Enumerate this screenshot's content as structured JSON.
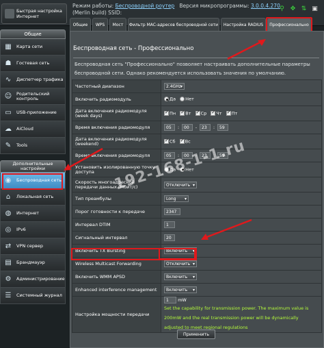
{
  "header": {
    "quick_setup_label": "Быстрая настройка Интернет",
    "mode_label": "Режим работы:",
    "mode_value": "Беспроводной роутер",
    "firmware_label": "Версия микропрограммы:",
    "firmware_value": "3.0.0.4.270",
    "build_text": "(Merlin build) SSID:"
  },
  "tabs": [
    {
      "label": "Общие"
    },
    {
      "label": "WPS"
    },
    {
      "label": "Мост"
    },
    {
      "label": "Фильтр MAC-адресов беспроводной сети"
    },
    {
      "label": "Настройка RADIUS"
    },
    {
      "label": "Профессионально"
    }
  ],
  "sidebar": {
    "general_header": "Общие",
    "general_items": [
      {
        "label": "Карта сети",
        "icon": "network-map-icon"
      },
      {
        "label": "Гостевая сеть",
        "icon": "guest-network-icon"
      },
      {
        "label": "Диспетчер трафика",
        "icon": "traffic-manager-icon"
      },
      {
        "label": "Родительский контроль",
        "icon": "parental-control-icon"
      },
      {
        "label": "USB-приложение",
        "icon": "usb-icon"
      },
      {
        "label": "AiCloud",
        "icon": "cloud-icon"
      },
      {
        "label": "Tools",
        "icon": "tools-icon"
      }
    ],
    "advanced_header": "Дополнительные настройки",
    "advanced_items": [
      {
        "label": "Беспроводная сеть",
        "icon": "wireless-icon"
      },
      {
        "label": "Локальная сеть",
        "icon": "lan-icon"
      },
      {
        "label": "Интернет",
        "icon": "internet-icon"
      },
      {
        "label": "IPv6",
        "icon": "ipv6-icon"
      },
      {
        "label": "VPN сервер",
        "icon": "vpn-icon"
      },
      {
        "label": "Брандмауэр",
        "icon": "firewall-icon"
      },
      {
        "label": "Администрирование",
        "icon": "admin-icon"
      },
      {
        "label": "Системный журнал",
        "icon": "log-icon"
      }
    ]
  },
  "panel": {
    "title": "Беспроводная сеть - Профессионально",
    "description": "Беспроводная сеть \"Профессионально\" позволяет настраивать дополнительные параметры беспроводной сети. Однако рекомендуется использовать значения по умолчанию."
  },
  "form": {
    "band_label": "Частотный диапазон",
    "band_value": "2.4GHz",
    "radio_label": "Включить радиомодуль",
    "yes": "Да",
    "no": "Нет",
    "weekdays_label": "Дата включения радиомодуля (week days)",
    "days": [
      "Пн",
      "Вт",
      "Ср",
      "Чт",
      "Пт"
    ],
    "time_label": "Время включения радиомодуля",
    "time_weekday": [
      "05",
      "00",
      "23",
      "59"
    ],
    "weekend_label": "Дата включения радиомодуля (weekend)",
    "weekend_days": [
      "Сб",
      "Вс"
    ],
    "time_weekend_label": "Время включения радиомодуля",
    "time_weekend": [
      "05",
      "00",
      "23",
      "59"
    ],
    "isolate_label": "Установить изолированную точку доступа",
    "multicast_rate_label": "Скорость многоадресной передачи данных (Мбит/с)",
    "multicast_rate_value": "Отключить",
    "preamble_label": "Тип преамбулы",
    "preamble_value": "Long",
    "rts_label": "Порог готовности к передаче",
    "rts_value": "2347",
    "dtim_label": "Интервал DTIM",
    "dtim_value": "1",
    "beacon_label": "Сигнальный интервал",
    "beacon_value": "20",
    "txburst_label": "Включить TX Bursting",
    "txburst_value": "Включить",
    "wmf_label": "Wireless Multicast Forwarding",
    "wmf_value": "Отключить",
    "apsd_label": "Включить WMM APSD",
    "apsd_value": "Включить",
    "interference_label": "Enhanced interference management",
    "interference_value": "Включить",
    "power_label": "Настройка мощности передачи",
    "power_value": "1",
    "power_unit": "mW",
    "power_note": "Set the capability for transmission power. The maximum value is 200mW and the real transmission power will be dynamically adjusted to meet regional regulations"
  },
  "apply_label": "Применить",
  "watermark": "192-168-1-1.ru",
  "colors": {
    "highlight": "#e0191c",
    "accent_blue": "#4a9bd4",
    "note_green": "#b6ff3a"
  }
}
